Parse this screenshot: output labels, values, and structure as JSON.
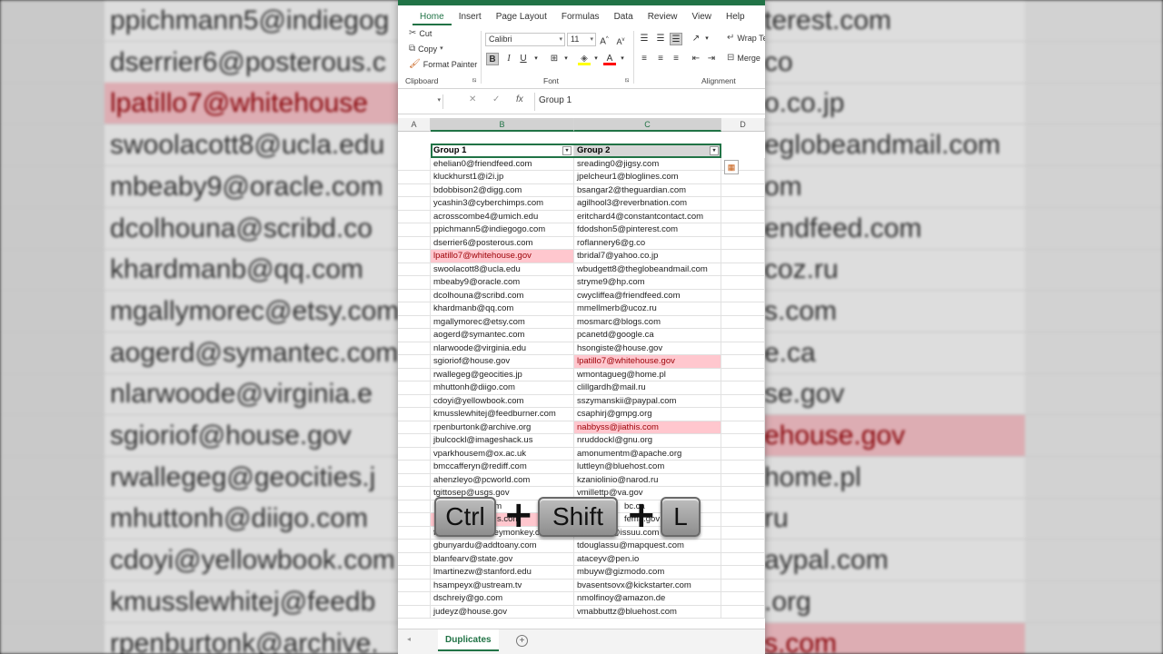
{
  "ribbon": {
    "tabs": [
      "Home",
      "Insert",
      "Page Layout",
      "Formulas",
      "Data",
      "Review",
      "View",
      "Help"
    ],
    "active_tab": "Home",
    "clipboard": {
      "cut": "Cut",
      "copy": "Copy",
      "format_painter": "Format Painter",
      "label": "Clipboard"
    },
    "font": {
      "name": "Calibri",
      "size": "11",
      "label": "Font",
      "bold": "B",
      "italic": "I",
      "underline": "U"
    },
    "alignment": {
      "wrap": "Wrap Te",
      "merge": "Merge",
      "label": "Alignment"
    }
  },
  "formula_bar": {
    "name_box": "",
    "content": "Group 1"
  },
  "columns": [
    "A",
    "B",
    "C",
    "D"
  ],
  "sheet": {
    "header_b": "Group 1",
    "header_c": "Group 2",
    "rows": [
      [
        "ehelian0@friendfeed.com",
        "sreading0@jigsy.com"
      ],
      [
        "kluckhurst1@i2i.jp",
        "jpelcheur1@bloglines.com"
      ],
      [
        "bdobbison2@digg.com",
        "bsangar2@theguardian.com"
      ],
      [
        "ycashin3@cyberchimps.com",
        "agilhool3@reverbnation.com"
      ],
      [
        "acrosscombe4@umich.edu",
        "eritchard4@constantcontact.com"
      ],
      [
        "ppichmann5@indiegogo.com",
        "fdodshon5@pinterest.com"
      ],
      [
        "dserrier6@posterous.com",
        "roflannery6@g.co"
      ],
      [
        "lpatillo7@whitehouse.gov",
        "tbridal7@yahoo.co.jp"
      ],
      [
        "swoolacott8@ucla.edu",
        "wbudgett8@theglobeandmail.com"
      ],
      [
        "mbeaby9@oracle.com",
        "stryme9@hp.com"
      ],
      [
        "dcolhouna@scribd.com",
        "cwycliffea@friendfeed.com"
      ],
      [
        "khardmanb@qq.com",
        "mmellmerb@ucoz.ru"
      ],
      [
        "mgallymorec@etsy.com",
        "mosmarc@blogs.com"
      ],
      [
        "aogerd@symantec.com",
        "pcanetd@google.ca"
      ],
      [
        "nlarwoode@virginia.edu",
        "hsongiste@house.gov"
      ],
      [
        "sgioriof@house.gov",
        "lpatillo7@whitehouse.gov"
      ],
      [
        "rwallegeg@geocities.jp",
        "wmontagueg@home.pl"
      ],
      [
        "mhuttonh@diigo.com",
        "clillgardh@mail.ru"
      ],
      [
        "cdoyi@yellowbook.com",
        "sszymanskii@paypal.com"
      ],
      [
        "kmusslewhitej@feedburner.com",
        "csaphirj@gmpg.org"
      ],
      [
        "rpenburtonk@archive.org",
        "nabbyss@jiathis.com"
      ],
      [
        "jbulcockl@imageshack.us",
        "nruddockl@gnu.org"
      ],
      [
        "vparkhousem@ox.ac.uk",
        "amonumentm@apache.org"
      ],
      [
        "bmccafferyn@rediff.com",
        "luttleyn@bluehost.com"
      ],
      [
        "ahenzleyo@pcworld.com",
        "kzaniolinio@narod.ru"
      ],
      [
        "tgittosep@usgs.gov",
        "vmillettp@va.gov"
      ],
      [
        "",
        ""
      ],
      [
        "",
        ""
      ],
      [
        "felsmeret@surveymonkey.com",
        "sellgoodt@issuu.com"
      ],
      [
        "gbunyardu@addtoany.com",
        "tdouglassu@mapquest.com"
      ],
      [
        "blanfearv@state.gov",
        "ataceyv@pen.io"
      ],
      [
        "lmartinezw@stanford.edu",
        "mbuyw@gizmodo.com"
      ],
      [
        "hsampeyx@ustream.tv",
        "bvasentsovx@kickstarter.com"
      ],
      [
        "dschreiy@go.com",
        "nmolfinoy@amazon.de"
      ],
      [
        "judeyz@house.gov",
        "vmabbuttz@bluehost.com"
      ]
    ],
    "partial_rows": {
      "r27_b": "ag.com",
      "r27_c": "bc.ca",
      "r28_b": "s.com",
      "r28_c": "fema.gov",
      "r28_c2": "re.de"
    },
    "duplicates": [
      {
        "row": 7,
        "col": "b"
      },
      {
        "row": 15,
        "col": "c"
      },
      {
        "row": 20,
        "col": "c"
      },
      {
        "row": 27,
        "col": "b"
      }
    ]
  },
  "sheet_tab": "Duplicates",
  "background": {
    "left": [
      "ppichmann5@indiegog",
      "dserrier6@posterous.c",
      "lpatillo7@whitehouse",
      "swoolacott8@ucla.edu",
      "mbeaby9@oracle.com",
      "dcolhouna@scribd.co",
      "khardmanb@qq.com",
      "mgallymorec@etsy.com",
      "aogerd@symantec.com",
      "nlarwoode@virginia.e",
      "sgioriof@house.gov",
      "rwallegeg@geocities.j",
      "mhuttonh@diigo.com",
      "cdoyi@yellowbook.com",
      "kmusslewhitej@feedb",
      "rpenburtonk@archive."
    ],
    "right": [
      "terest.com",
      "co",
      "o.co.jp",
      "eglobeandmail.com",
      "om",
      "endfeed.com",
      "coz.ru",
      "s.com",
      "e.ca",
      "se.gov",
      "ehouse.gov",
      "home.pl",
      "ru",
      "aypal.com",
      ".org",
      "s.com"
    ],
    "hl_left": [
      2
    ],
    "hl_right": [
      10,
      15
    ]
  },
  "keys": [
    "Ctrl",
    "Shift",
    "L"
  ],
  "colors": {
    "accent": "#217346",
    "dup_fill": "#ffc7ce",
    "dup_text": "#9c0006"
  }
}
